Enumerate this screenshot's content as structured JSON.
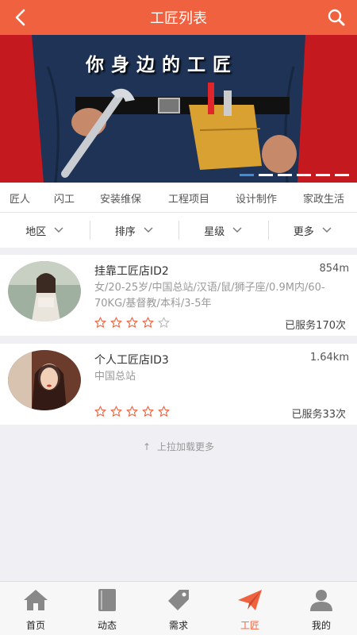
{
  "header": {
    "title": "工匠列表",
    "back_icon": "chevron-left-icon",
    "search_icon": "search-icon"
  },
  "banner": {
    "caption": "你身边的工匠",
    "slides": 6,
    "active_slide": 0
  },
  "categories": [
    "匠人",
    "闪工",
    "安装维保",
    "工程项目",
    "设计制作",
    "家政生活"
  ],
  "filters": [
    {
      "label": "地区"
    },
    {
      "label": "排序"
    },
    {
      "label": "星级"
    },
    {
      "label": "更多"
    }
  ],
  "craftsmen": [
    {
      "name": "挂靠工匠店ID2",
      "distance": "854m",
      "description": "女/20-25岁/中国总站/汉语/鼠/狮子座/0.9M内/60-70KG/基督教/本科/3-5年",
      "rating": 4,
      "max_rating": 5,
      "served": "已服务170次"
    },
    {
      "name": "个人工匠店ID3",
      "distance": "1.64km",
      "description": "中国总站",
      "rating": 5,
      "max_rating": 5,
      "served": "已服务33次"
    }
  ],
  "load_more": "上拉加载更多",
  "tabs": [
    {
      "label": "首页",
      "icon": "home-icon"
    },
    {
      "label": "动态",
      "icon": "book-icon"
    },
    {
      "label": "需求",
      "icon": "tag-icon"
    },
    {
      "label": "工匠",
      "icon": "paper-plane-icon",
      "active": true
    },
    {
      "label": "我的",
      "icon": "user-icon"
    }
  ],
  "colors": {
    "accent": "#f0623f",
    "star": "#f0623f",
    "inactive_icon": "#888888",
    "background": "#efeff4"
  }
}
